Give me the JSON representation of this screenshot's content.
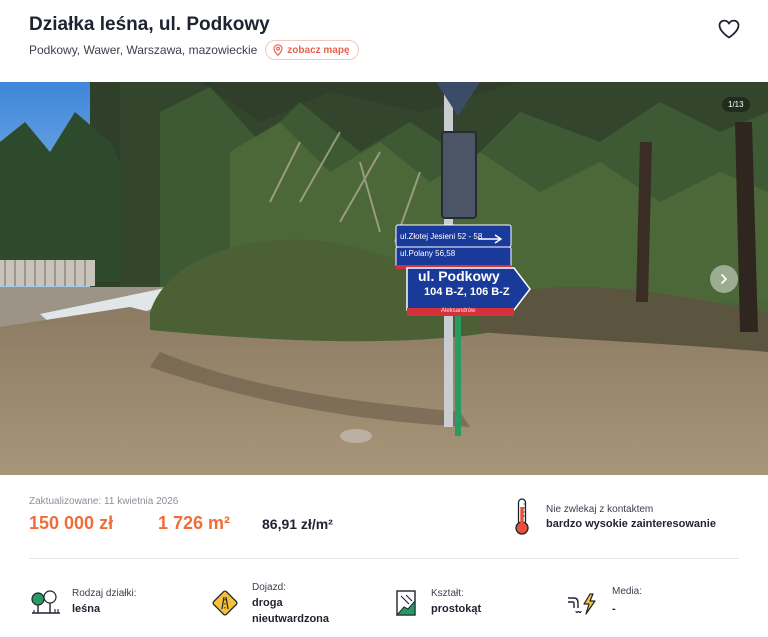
{
  "listing": {
    "title": "Działka leśna, ul. Podkowy",
    "address": "Podkowy, Wawer, Warszawa, mazowieckie",
    "map_link_label": "zobacz mapę"
  },
  "icons": {
    "favorite": "heart-icon",
    "map": "map-pin-icon",
    "next": "chevron-right-icon",
    "interest": "thermometer-icon",
    "plot_type": "trees-icon",
    "access": "road-icon",
    "shape": "plot-shape-icon",
    "utilities": "utilities-icon"
  },
  "gallery": {
    "counter": "1/13",
    "signs": {
      "line1": "ul.Złotej Jesieni 52 - 58",
      "line2": "ul.Polany 56,58",
      "main": "ul. Podkowy",
      "numbers": "104 B-Z, 106 B-Z",
      "district": "Aleksandrów"
    }
  },
  "summary": {
    "updated": "Zaktualizowane: 11 kwietnia 2026",
    "price": "150 000 zł",
    "area": "1 726 m²",
    "price_per_m2": "86,91 zł/m²"
  },
  "interest": {
    "label": "Nie zwlekaj z kontaktem",
    "value": "bardzo wysokie zainteresowanie"
  },
  "features": [
    {
      "label": "Rodzaj działki:",
      "value": "leśna"
    },
    {
      "label": "Dojazd:",
      "value_line1": "droga",
      "value_line2": "nieutwardzona"
    },
    {
      "label": "Kształt:",
      "value": "prostokąt"
    },
    {
      "label": "Media:",
      "value": "-"
    }
  ],
  "colors": {
    "accent": "#ee6d3a",
    "text": "#1f2330",
    "sign_blue": "#1a3a9a",
    "sign_red": "#d6303a"
  }
}
